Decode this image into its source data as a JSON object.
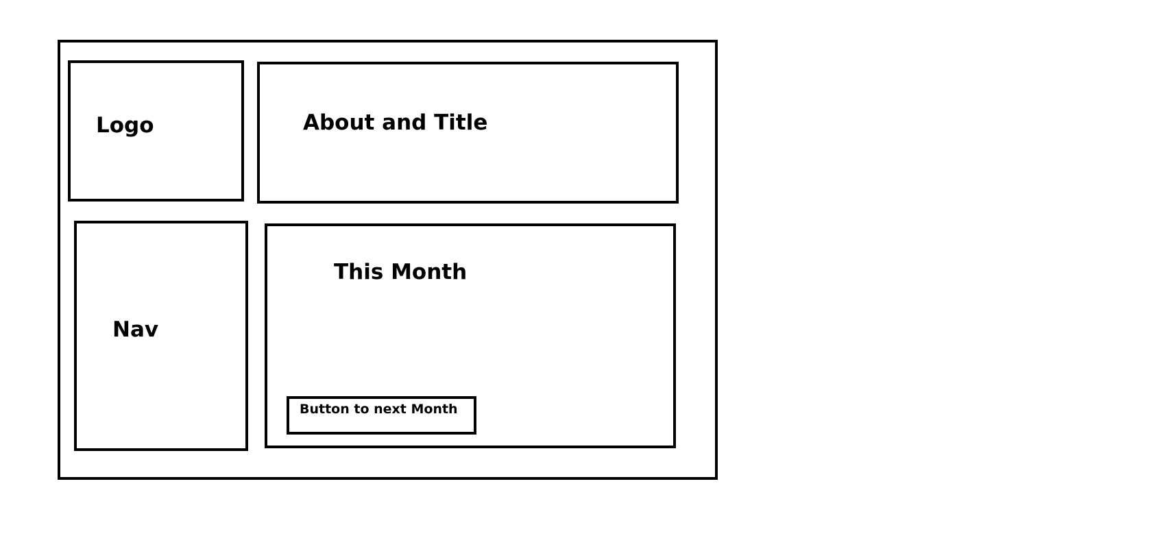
{
  "logo": {
    "label": "Logo"
  },
  "about": {
    "label": "About and Title"
  },
  "nav": {
    "label": "Nav"
  },
  "this_month": {
    "label": "This Month"
  },
  "next_month_button": {
    "label": "Button to next Month"
  }
}
